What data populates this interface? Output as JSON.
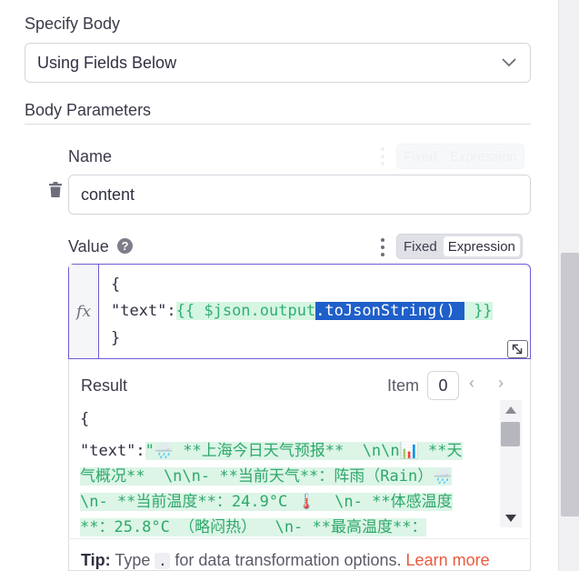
{
  "specify_body": {
    "label": "Specify Body",
    "selected": "Using Fields Below"
  },
  "body_parameters": {
    "heading": "Body Parameters"
  },
  "name_field": {
    "label": "Name",
    "value": "content",
    "toggle_fixed": "Fixed",
    "toggle_expression": "Expression"
  },
  "value_field": {
    "label": "Value",
    "help": "?",
    "toggle_fixed": "Fixed",
    "toggle_expression": "Expression",
    "fx": "fx",
    "code": {
      "line1": "{",
      "key": "\"text\":",
      "expr_open": "{{ $json.output",
      "expr_selected": ".toJsonString() ",
      "expr_close": " }}",
      "line3": "}"
    }
  },
  "result": {
    "heading": "Result",
    "item_label": "Item",
    "item_index": "0",
    "prev": "‹",
    "next": "›",
    "lines": {
      "l1": "{",
      "l2_key": "\"text\":",
      "l2_val": "\"🌧️ **上海今日天气预报**  \\n\\n📊 **天",
      "l3": "气概况**  \\n\\n- **当前天气**：阵雨（Rain）🌧️",
      "l4": "\\n- **当前温度**：24.9°C 🌡️  \\n- **体感温度",
      "l5": "**：25.8°C （略闷热）  \\n- **最高温度**："
    }
  },
  "tip": {
    "prefix": "Tip:",
    "before": " Type ",
    "code": ".",
    "after": " for data transformation options. ",
    "link": "Learn more"
  },
  "icons": {
    "chevron": "chevron-down-icon",
    "trash": "trash-icon",
    "help": "help-circle-icon",
    "kebab": "kebab-menu-icon",
    "resize": "resize-icon"
  },
  "colors": {
    "accent": "#6f5bd3",
    "expression_green": "#2fb074",
    "selection": "#1f5fc9",
    "link": "#ea5a3e"
  }
}
